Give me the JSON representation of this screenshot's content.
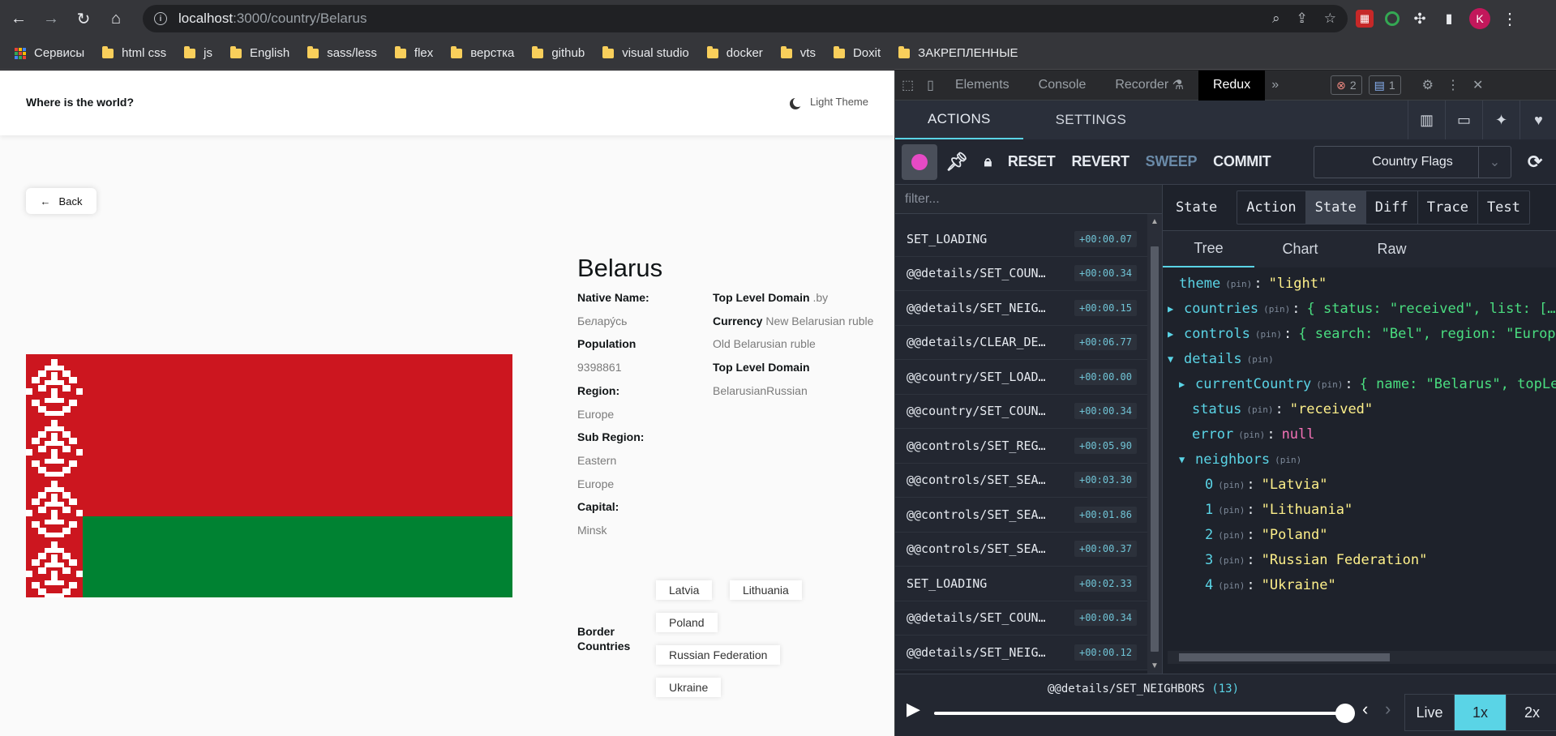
{
  "browser": {
    "url_host": "localhost",
    "url_path": ":3000/country/Belarus",
    "profile_initial": "K",
    "bookmarks": [
      "Сервисы",
      "html css",
      "js",
      "English",
      "sass/less",
      "flex",
      "верстка",
      "github",
      "visual studio",
      "docker",
      "vts",
      "Doxit",
      "ЗАКРЕПЛЕННЫЕ"
    ]
  },
  "app": {
    "title": "Where is the world?",
    "theme_label": "Light Theme",
    "back_label": "Back",
    "country": {
      "name": "Belarus",
      "col1": [
        {
          "label": "Native Name:",
          "value": "Белару́сь"
        },
        {
          "label": "Population",
          "value": "9398861"
        },
        {
          "label": "Region:",
          "value": "Europe"
        },
        {
          "label": "Sub Region:",
          "value": "Eastern Europe"
        },
        {
          "label": "Capital:",
          "value": "Minsk"
        }
      ],
      "tld_label": "Top Level Domain",
      "tld_value": ".by",
      "currency_label": "Currency",
      "currency_value": "New Belarusian ruble Old Belarusian ruble",
      "languages_label": "Top Level Domain",
      "languages_value": "BelarusianRussian",
      "border_label": "Border Countries",
      "borders": [
        "Latvia",
        "Lithuania",
        "Poland",
        "Russian Federation",
        "Ukraine"
      ]
    },
    "flag_colors": {
      "red": "#cc161f",
      "green": "#008232",
      "white": "#ffffff"
    }
  },
  "devtools": {
    "tabs": [
      "Elements",
      "Console",
      "Recorder",
      "Redux"
    ],
    "active_tab": "Redux",
    "errors": "2",
    "messages": "1"
  },
  "redux": {
    "top_tabs": [
      "ACTIONS",
      "SETTINGS"
    ],
    "toolbar": [
      "RESET",
      "REVERT",
      "SWEEP",
      "COMMIT"
    ],
    "monitor": "Country Flags",
    "filter_placeholder": "filter...",
    "actions": [
      {
        "name": "SET_LOADING",
        "time": "+00:00.07"
      },
      {
        "name": "@@details/SET_COUN…",
        "time": "+00:00.34"
      },
      {
        "name": "@@details/SET_NEIG…",
        "time": "+00:00.15"
      },
      {
        "name": "@@details/CLEAR_DE…",
        "time": "+00:06.77"
      },
      {
        "name": "@@country/SET_LOAD…",
        "time": "+00:00.00"
      },
      {
        "name": "@@country/SET_COUN…",
        "time": "+00:00.34"
      },
      {
        "name": "@@controls/SET_REG…",
        "time": "+00:05.90"
      },
      {
        "name": "@@controls/SET_SEA…",
        "time": "+00:03.30"
      },
      {
        "name": "@@controls/SET_SEA…",
        "time": "+00:01.86"
      },
      {
        "name": "@@controls/SET_SEA…",
        "time": "+00:00.37"
      },
      {
        "name": "SET_LOADING",
        "time": "+00:02.33"
      },
      {
        "name": "@@details/SET_COUN…",
        "time": "+00:00.34"
      },
      {
        "name": "@@details/SET_NEIG…",
        "time": "+00:00.12"
      }
    ],
    "inspector_label": "State",
    "inspector_tabs": [
      "Action",
      "State",
      "Diff",
      "Trace",
      "Test"
    ],
    "inspector_active": "State",
    "view_tabs": [
      "Tree",
      "Chart",
      "Raw"
    ],
    "view_active": "Tree",
    "pin": "(pin)",
    "tree": {
      "theme": "\"light\"",
      "countries": "{ status: \"received\", list: […],",
      "controls": "{ search: \"Bel\", region: \"Europe\"",
      "details": "",
      "currentCountry": "{ name: \"Belarus\", topLeve",
      "status": "\"received\"",
      "error": "null",
      "neighbors": [
        "\"Latvia\"",
        "\"Lithuania\"",
        "\"Poland\"",
        "\"Russian Federation\"",
        "\"Ukraine\""
      ]
    },
    "slider_action": "@@details/SET_NEIGHBORS",
    "slider_index": "(13)",
    "speeds": [
      "Live",
      "1x",
      "2x"
    ],
    "speed_active": "1x"
  }
}
